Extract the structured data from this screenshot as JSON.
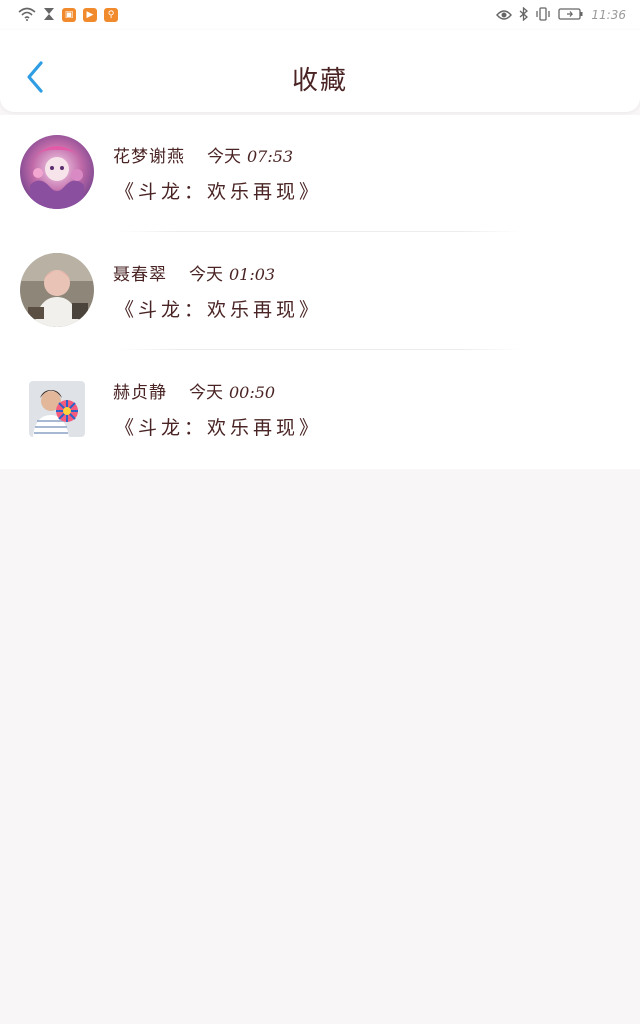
{
  "status_bar": {
    "time": "11:36",
    "left_icons": [
      "wifi-icon",
      "hourglass-icon",
      "game-app-icon",
      "video-app-icon",
      "accessibility-app-icon"
    ],
    "right_icons": [
      "eye-icon",
      "bluetooth-icon",
      "vibrate-icon",
      "battery-charging-icon"
    ]
  },
  "header": {
    "title": "收藏",
    "back_icon": "chevron-left-icon"
  },
  "favorites": [
    {
      "name": "花梦谢燕",
      "day": "今天",
      "time": "07:53",
      "message": "《斗龙：欢乐再现》",
      "avatar": "anime-avatar"
    },
    {
      "name": "聂春翠",
      "day": "今天",
      "time": "01:03",
      "message": "《斗龙：欢乐再现》",
      "avatar": "person-photo-avatar"
    },
    {
      "name": "赫贞静",
      "day": "今天",
      "time": "00:50",
      "message": "《斗龙：欢乐再现》",
      "avatar": "person-with-toy-avatar"
    }
  ],
  "colors": {
    "accent": "#2e9de4",
    "text": "#4a2424",
    "background": "#f8f6f6",
    "surface": "#ffffff"
  }
}
